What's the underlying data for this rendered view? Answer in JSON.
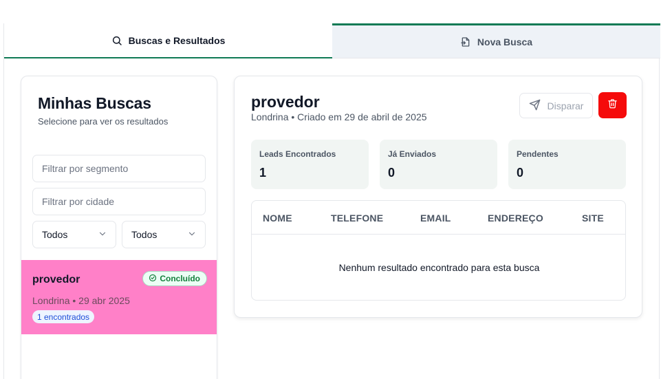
{
  "tabs": {
    "results_label": "Buscas e Resultados",
    "new_label": "Nova Busca"
  },
  "sidebar": {
    "title": "Minhas Buscas",
    "subtitle": "Selecione para ver os resultados",
    "segment_placeholder": "Filtrar por segmento",
    "city_placeholder": "Filtrar por cidade",
    "select_one": "Todos",
    "select_two": "Todos",
    "items": [
      {
        "name": "provedor",
        "status": "Concluído",
        "meta": "Londrina • 29 abr 2025",
        "count": "1 encontrados"
      }
    ]
  },
  "detail": {
    "title": "provedor",
    "meta": "Londrina • Criado em 29 de abril de 2025",
    "send_label": "Disparar",
    "stats": [
      {
        "label": "Leads Encontrados",
        "value": "1"
      },
      {
        "label": "Já Enviados",
        "value": "0"
      },
      {
        "label": "Pendentes",
        "value": "0"
      }
    ],
    "table": {
      "columns": [
        "NOME",
        "TELEFONE",
        "EMAIL",
        "ENDEREÇO",
        "SITE"
      ],
      "empty_message": "Nenhum resultado encontrado para esta busca"
    }
  },
  "colors": {
    "accent": "#0f7a55",
    "selected_item": "#ff80c8",
    "delete_button": "#f50b0b",
    "stat_background": "#f1f5f3"
  },
  "icons": {
    "results_tab": "search-icon",
    "new_tab": "file-plus-icon",
    "send_button": "send-icon",
    "delete_button": "trash-icon",
    "status_badge": "check-circle-icon",
    "select": "chevron-down-icon"
  }
}
